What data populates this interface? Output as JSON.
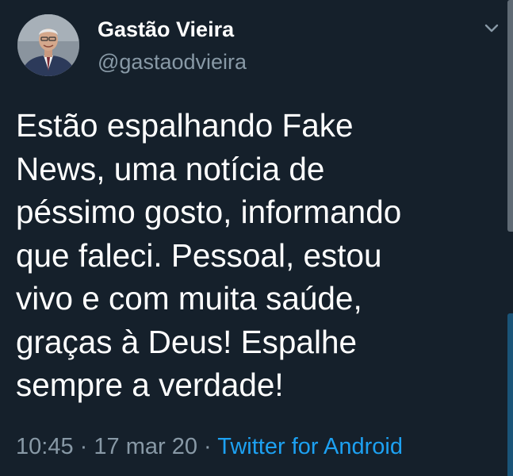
{
  "author": {
    "display_name": "Gastão Vieira",
    "handle": "@gastaodvieira"
  },
  "tweet": {
    "text": "Estão espalhando Fake\nNews, uma notícia de\npéssimo gosto, informando\nque faleci. Pessoal, estou\nvivo e com muita saúde,\ngraças à Deus! Espalhe\nsempre a verdade!",
    "time": "10:45",
    "date": "17 mar 20",
    "separator": "·",
    "source": "Twitter for Android"
  },
  "icons": {
    "menu": "chevron-down-icon"
  },
  "colors": {
    "background": "#15202b",
    "primary_text": "#ffffff",
    "secondary_text": "#8899a6",
    "link": "#1da1f2"
  }
}
